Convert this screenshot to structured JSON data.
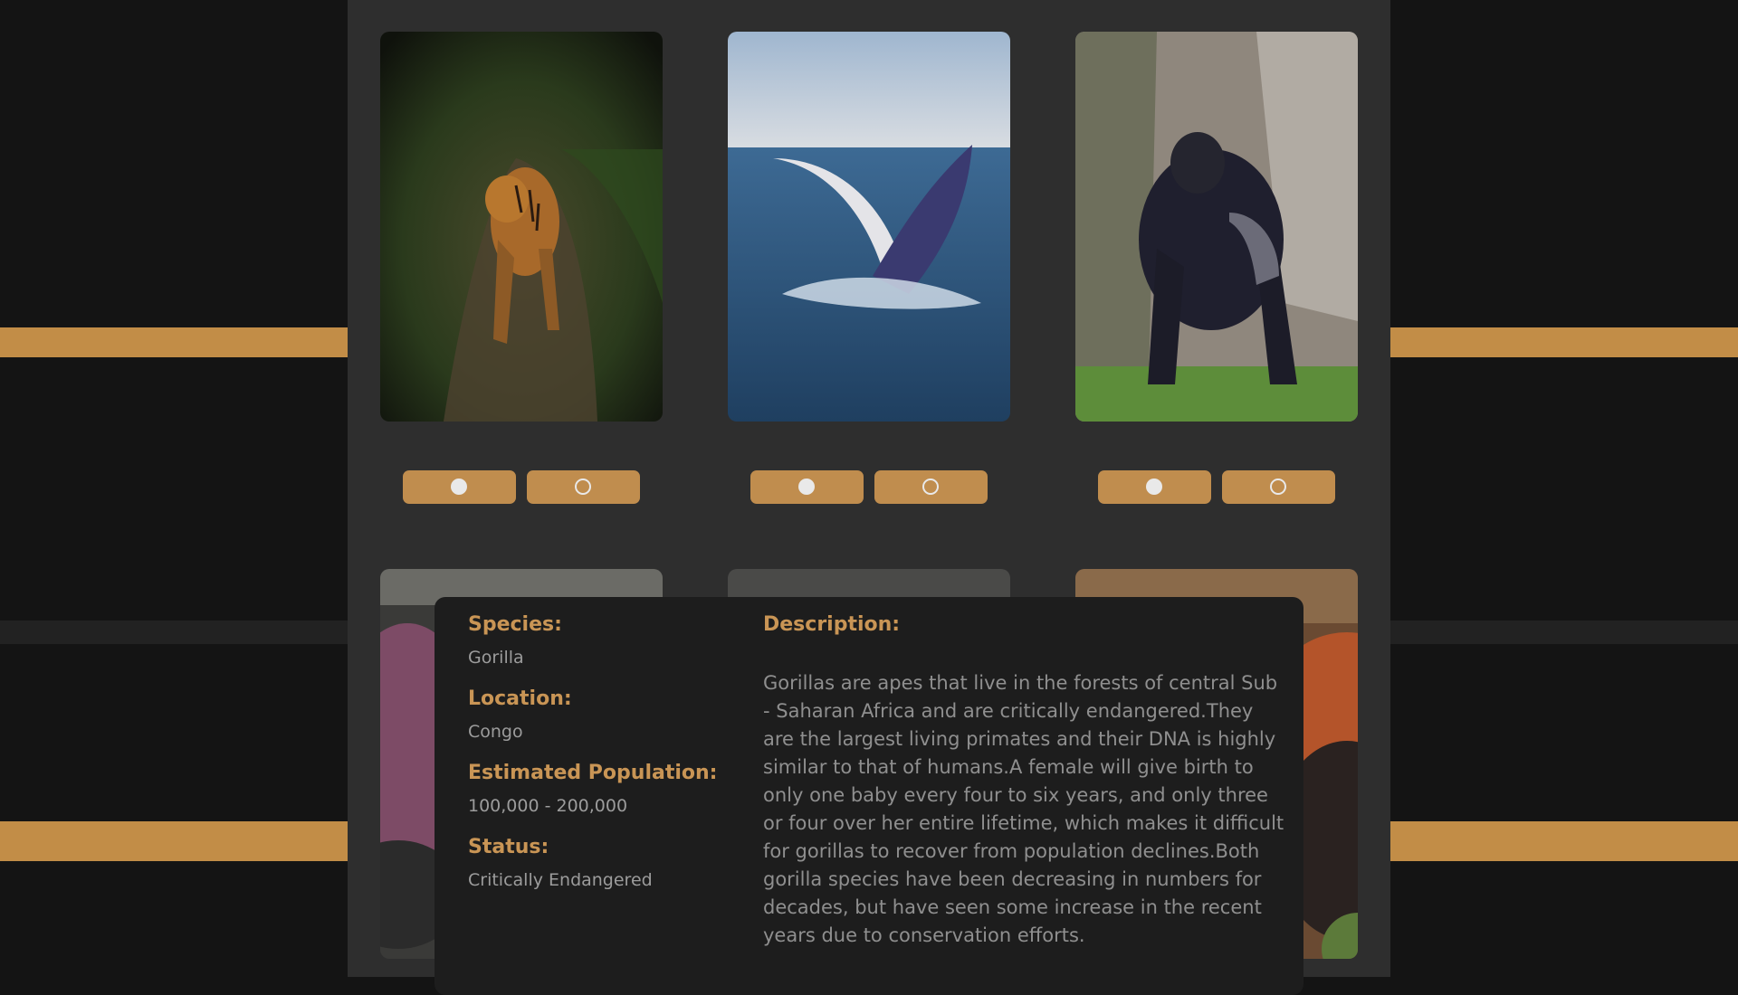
{
  "colors": {
    "accent": "#c08d4e",
    "page_background": "#141414",
    "panel_background": "#2e2e2e",
    "modal_background": "#1d1d1d"
  },
  "gallery": {
    "cards": [
      {
        "animal": "tiger",
        "buttons": [
          {
            "icon": "filled-dot-icon"
          },
          {
            "icon": "hollow-dot-icon"
          }
        ]
      },
      {
        "animal": "whale",
        "buttons": [
          {
            "icon": "filled-dot-icon"
          },
          {
            "icon": "hollow-dot-icon"
          }
        ]
      },
      {
        "animal": "gorilla",
        "buttons": [
          {
            "icon": "filled-dot-icon"
          },
          {
            "icon": "hollow-dot-icon"
          }
        ]
      }
    ]
  },
  "detail": {
    "species_label": "Species:",
    "species_value": "Gorilla",
    "location_label": "Location:",
    "location_value": "Congo",
    "population_label": "Estimated Population:",
    "population_value": "100,000 - 200,000",
    "status_label": "Status:",
    "status_value": "Critically Endangered",
    "description_label": "Description:",
    "description_text": "Gorillas are apes that live in the forests of central Sub - Saharan Africa and are critically endangered.They are the largest living primates and their DNA is highly similar to that of humans.A female will give birth to only one baby every four to six years, and only three or four over her entire lifetime, which makes it difficult for gorillas to recover from population declines.Both gorilla species have been decreasing in numbers for decades, but have seen some increase in the recent years due to conservation efforts."
  }
}
